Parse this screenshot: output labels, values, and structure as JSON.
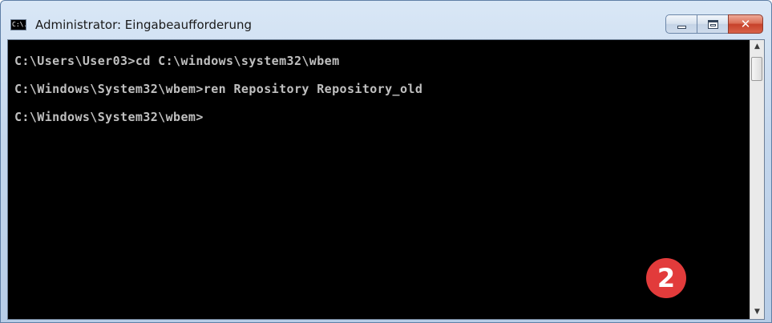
{
  "window": {
    "title": "Administrator: Eingabeaufforderung",
    "app_icon_label": "C:\\.",
    "controls": {
      "minimize": "minimize-icon",
      "maximize": "maximize-icon",
      "close_glyph": "✕"
    }
  },
  "console": {
    "lines": [
      "C:\\Users\\User03>cd C:\\windows\\system32\\wbem",
      "C:\\Windows\\System32\\wbem>ren Repository Repository_old",
      "C:\\Windows\\System32\\wbem>"
    ],
    "text_color": "#c0c0c0",
    "background": "#000000"
  },
  "badge": {
    "label": "2",
    "color": "#e23b3b"
  },
  "scrollbar": {
    "up_glyph": "▲",
    "down_glyph": "▼"
  }
}
